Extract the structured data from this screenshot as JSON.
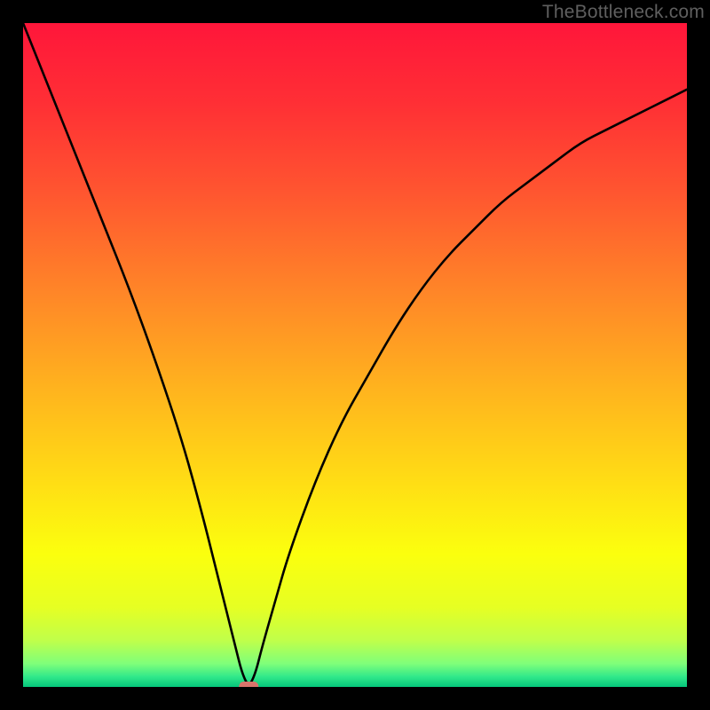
{
  "watermark": "TheBottleneck.com",
  "chart_data": {
    "type": "line",
    "title": "",
    "xlabel": "",
    "ylabel": "",
    "xlim": [
      0,
      100
    ],
    "ylim": [
      0,
      100
    ],
    "vertex_x": 34,
    "series": [
      {
        "name": "bottleneck-curve",
        "x": [
          0,
          4,
          8,
          12,
          16,
          20,
          24,
          27,
          29,
          31,
          32,
          33,
          34,
          35,
          36,
          38,
          40,
          44,
          48,
          52,
          56,
          60,
          64,
          68,
          72,
          76,
          80,
          84,
          88,
          92,
          96,
          100
        ],
        "values": [
          100,
          90,
          80,
          70,
          60,
          49,
          37,
          26,
          18,
          10,
          6,
          2,
          0,
          2,
          6,
          13,
          20,
          31,
          40,
          47,
          54,
          60,
          65,
          69,
          73,
          76,
          79,
          82,
          84,
          86,
          88,
          90
        ]
      }
    ],
    "marker": {
      "x": 34,
      "y": 0,
      "color": "#d9746b"
    },
    "gradient_stops": [
      {
        "offset": 0.0,
        "color": "#ff163a"
      },
      {
        "offset": 0.12,
        "color": "#ff2f35"
      },
      {
        "offset": 0.25,
        "color": "#ff5430"
      },
      {
        "offset": 0.4,
        "color": "#ff8428"
      },
      {
        "offset": 0.55,
        "color": "#ffb31e"
      },
      {
        "offset": 0.7,
        "color": "#ffe014"
      },
      {
        "offset": 0.8,
        "color": "#fbff0e"
      },
      {
        "offset": 0.88,
        "color": "#e6ff23"
      },
      {
        "offset": 0.93,
        "color": "#c0ff4a"
      },
      {
        "offset": 0.965,
        "color": "#7fff7a"
      },
      {
        "offset": 0.985,
        "color": "#30e88a"
      },
      {
        "offset": 1.0,
        "color": "#05c57b"
      }
    ]
  }
}
